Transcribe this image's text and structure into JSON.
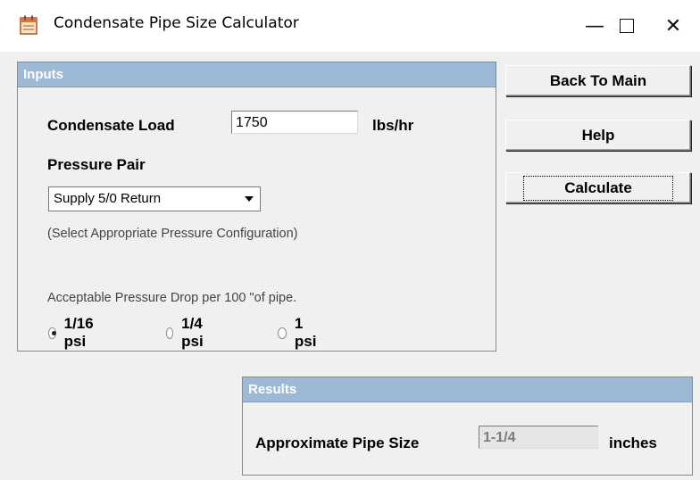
{
  "window": {
    "title": "Condensate Pipe Size Calculator",
    "icon": "calculator-app-icon",
    "controls": {
      "minimize": "—",
      "close": "✕"
    }
  },
  "inputs": {
    "header": "Inputs",
    "condensate_load_label": "Condensate Load",
    "condensate_load_value": "1750",
    "condensate_load_unit": "lbs/hr",
    "pressure_pair_label": "Pressure Pair",
    "pressure_pair_selected": "Supply 5/0 Return",
    "pressure_pair_hint": "(Select Appropriate Pressure Configuration)",
    "pressure_drop_label": "Acceptable Pressure Drop per 100 \"of pipe.",
    "pressure_drop_options": [
      {
        "label": "1/16 psi",
        "checked": true
      },
      {
        "label": "1/4 psi",
        "checked": false
      },
      {
        "label": "1 psi",
        "checked": false
      }
    ]
  },
  "buttons": {
    "back_to_main": "Back To Main",
    "help": "Help",
    "calculate": "Calculate"
  },
  "results": {
    "header": "Results",
    "pipe_size_label": "Approximate Pipe Size",
    "pipe_size_value": "1-1/4",
    "pipe_size_unit": "inches"
  },
  "colors": {
    "panel_header_bg": "#9eb9d6",
    "window_bg": "#f0f0f0"
  }
}
